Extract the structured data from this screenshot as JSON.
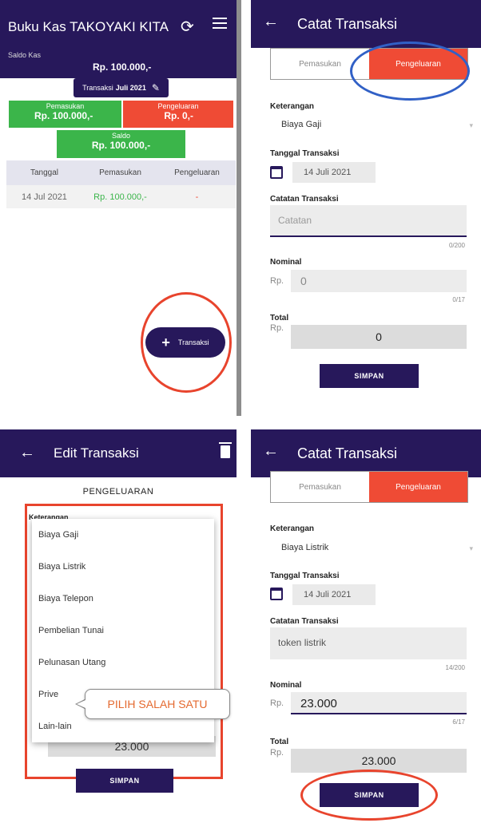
{
  "panel1": {
    "title": "Buku Kas TAKOYAKI KITA",
    "saldo_kas_label": "Saldo Kas",
    "saldo_kas_value": "Rp. 100.000,-",
    "transaksi_label": "Transaksi",
    "transaksi_month": "Juli 2021",
    "pemasukan_label": "Pemasukan",
    "pemasukan_value": "Rp. 100.000,-",
    "pengeluaran_label": "Pengeluaran",
    "pengeluaran_value": "Rp. 0,-",
    "saldo_label": "Saldo",
    "saldo_value": "Rp. 100.000,-",
    "table_headers": [
      "Tanggal",
      "Pemasukan",
      "Pengeluaran"
    ],
    "rows": [
      {
        "tanggal": "14 Jul 2021",
        "pemasukan": "Rp. 100.000,-",
        "pengeluaran": "-"
      }
    ],
    "fab_label": "Transaksi",
    "fab_plus": "+"
  },
  "panel2": {
    "back": "←",
    "title": "Catat Transaksi",
    "tab_pemasukan": "Pemasukan",
    "tab_pengeluaran": "Pengeluaran",
    "keterangan_label": "Keterangan",
    "keterangan_value": "Biaya Gaji",
    "tanggal_label": "Tanggal Transaksi",
    "tanggal_value": "14 Juli 2021",
    "catatan_label": "Catatan Transaksi",
    "catatan_placeholder": "Catatan",
    "catatan_counter": "0/200",
    "nominal_label": "Nominal",
    "rp": "Rp.",
    "nominal_value": "0",
    "nominal_counter": "0/17",
    "total_label": "Total",
    "total_value": "0",
    "simpan": "SIMPAN"
  },
  "panel3": {
    "back": "←",
    "title": "Edit Transaksi",
    "heading": "PENGELUARAN",
    "keterangan_label": "Keterangan",
    "options": [
      "Biaya Gaji",
      "Biaya Listrik",
      "Biaya Telepon",
      "Pembelian Tunai",
      "Pelunasan Utang",
      "Prive",
      "Lain-lain"
    ],
    "hint": "PILIH SALAH SATU",
    "total_value": "23.000",
    "simpan": "SIMPAN"
  },
  "panel4": {
    "back": "←",
    "title": "Catat Transaksi",
    "tab_pemasukan": "Pemasukan",
    "tab_pengeluaran": "Pengeluaran",
    "keterangan_label": "Keterangan",
    "keterangan_value": "Biaya Listrik",
    "tanggal_label": "Tanggal Transaksi",
    "tanggal_value": "14 Juli 2021",
    "catatan_label": "Catatan Transaksi",
    "catatan_value": "token listrik",
    "catatan_counter": "14/200",
    "nominal_label": "Nominal",
    "rp": "Rp.",
    "nominal_value": "23.000",
    "nominal_counter": "6/17",
    "total_label": "Total",
    "total_value": "23.000",
    "simpan": "SIMPAN"
  },
  "colors": {
    "primary": "#27185b",
    "green": "#3bb54a",
    "red": "#ef4b35",
    "annotation_red": "#e8442d",
    "annotation_blue": "#3160c6"
  }
}
